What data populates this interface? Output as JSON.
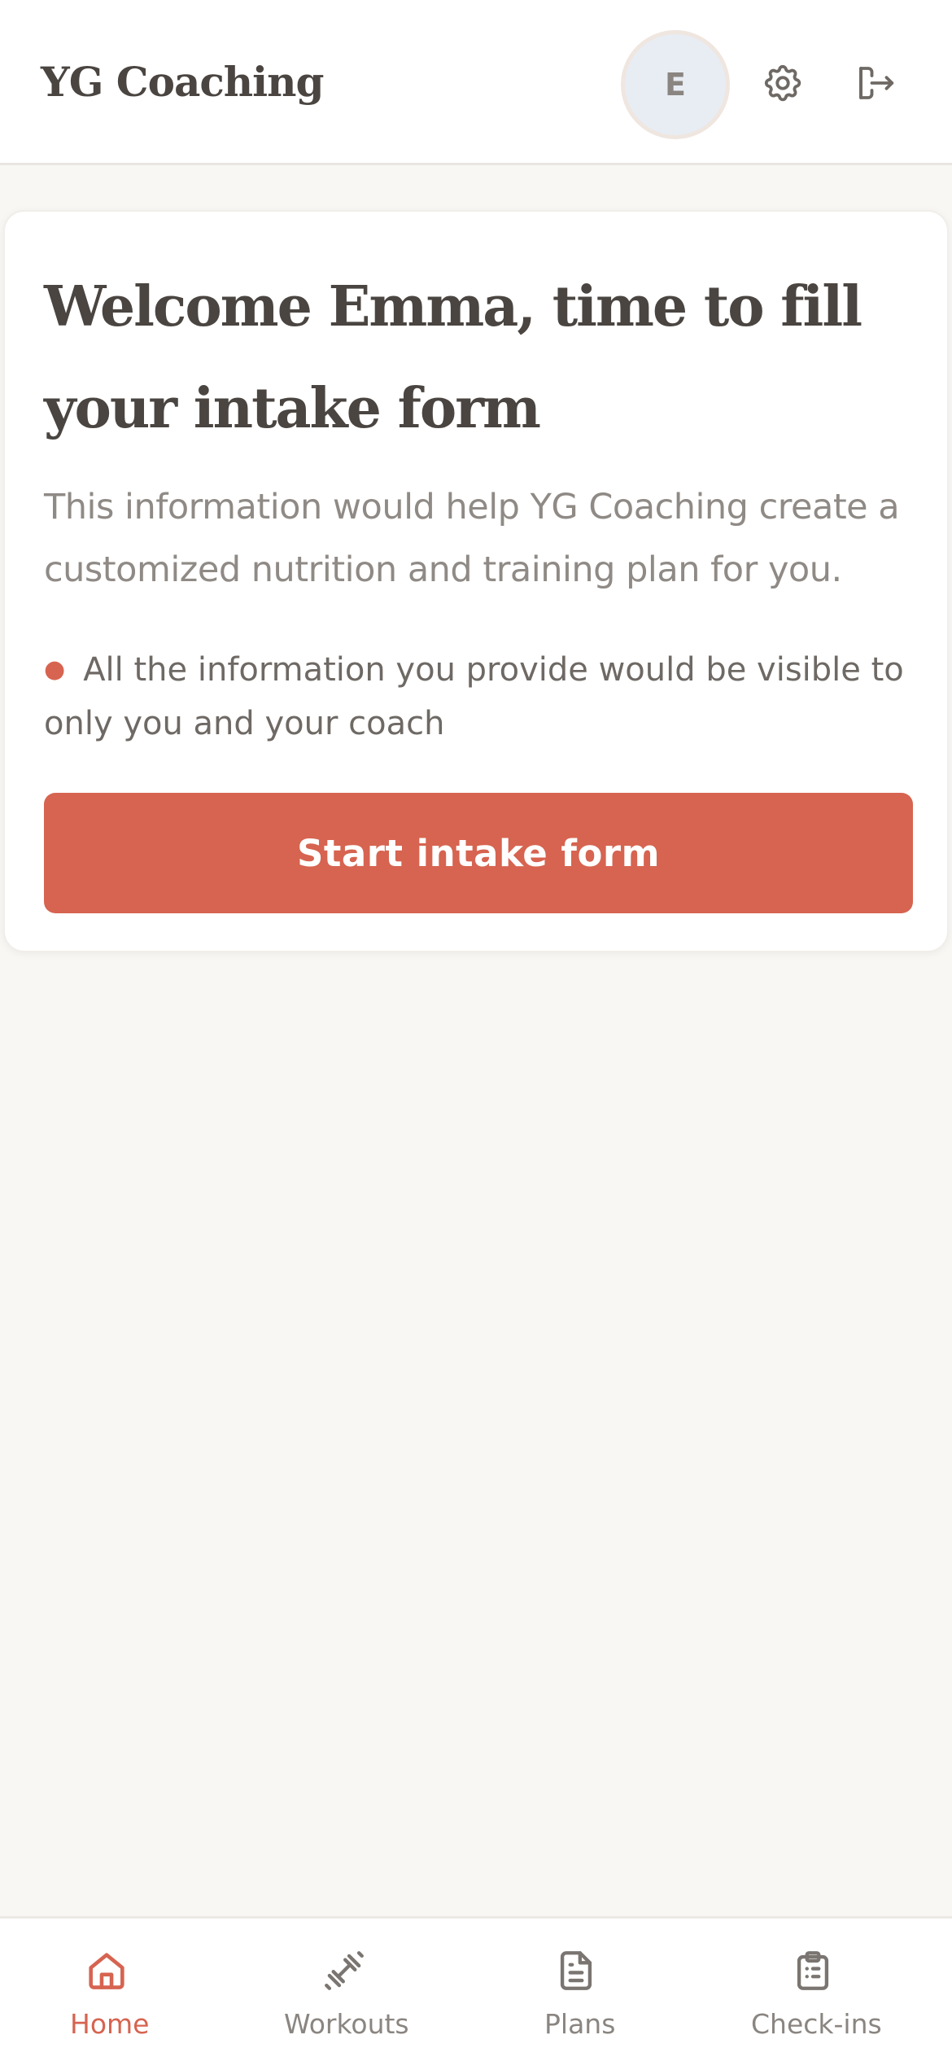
{
  "header": {
    "brand": "YG Coaching",
    "avatar_initial": "E",
    "settings_icon": "gear-icon",
    "logout_icon": "logout-icon"
  },
  "intake_card": {
    "title": "Welcome Emma, time to fill your intake form",
    "subtitle": "This information would help YG Coaching create a customized nutrition and training plan for you.",
    "bullet": "All the information you provide would be visible to only you and your coach",
    "cta_label": "Start intake form"
  },
  "bottom_nav": {
    "items": [
      {
        "label": "Home",
        "icon": "home-icon",
        "active": true
      },
      {
        "label": "Workouts",
        "icon": "dumbbell-icon",
        "active": false
      },
      {
        "label": "Plans",
        "icon": "document-icon",
        "active": false
      },
      {
        "label": "Check-ins",
        "icon": "clipboard-icon",
        "active": false
      }
    ]
  },
  "colors": {
    "accent": "#d66450",
    "text_primary": "#4a4541",
    "text_muted": "#8f8a85",
    "background": "#f8f7f4"
  }
}
